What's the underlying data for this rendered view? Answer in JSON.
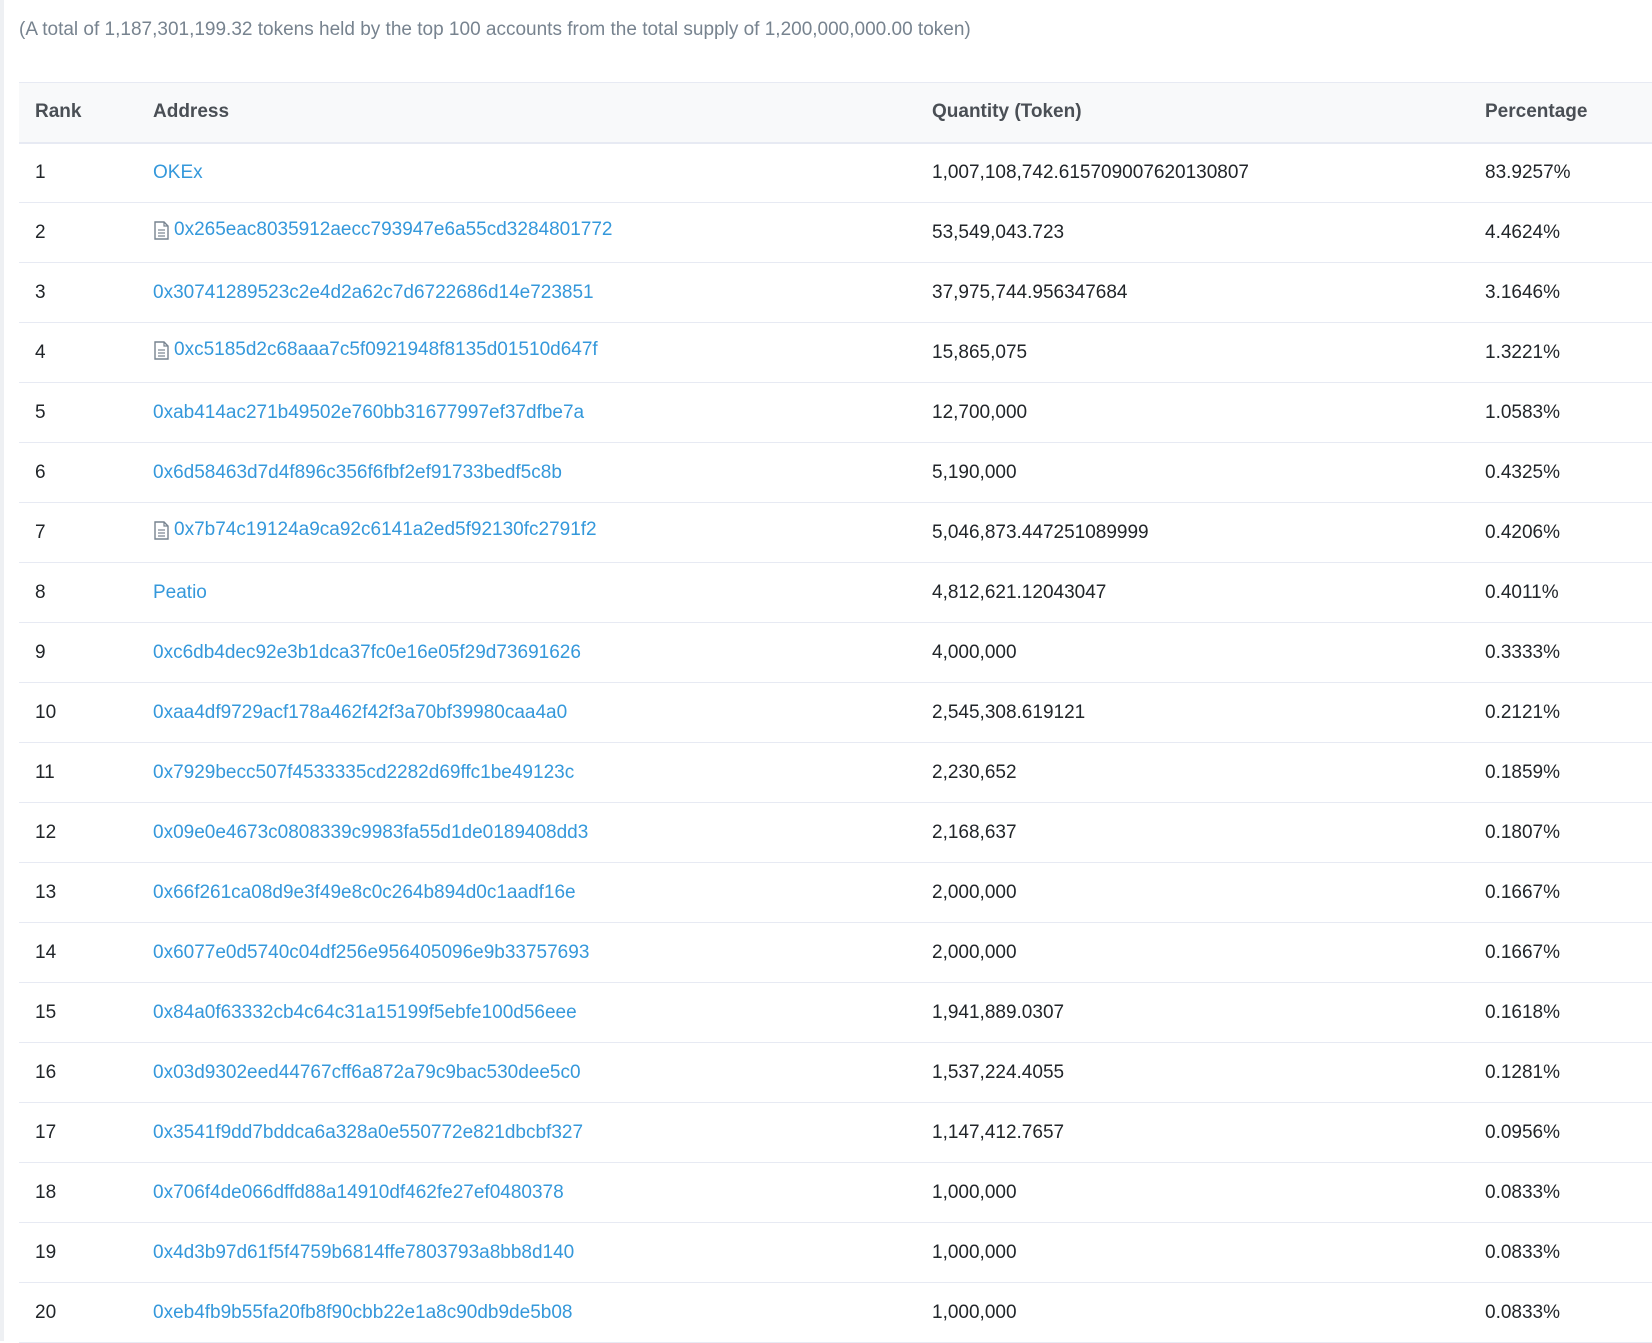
{
  "summary": "(A total of 1,187,301,199.32 tokens held by the top 100 accounts from the total supply of 1,200,000,000.00 token)",
  "table": {
    "headers": {
      "rank": "Rank",
      "address": "Address",
      "quantity": "Quantity (Token)",
      "percentage": "Percentage"
    },
    "rows": [
      {
        "rank": "1",
        "address": "OKEx",
        "contract": false,
        "quantity": "1,007,108,742.615709007620130807",
        "percentage": "83.9257%"
      },
      {
        "rank": "2",
        "address": "0x265eac8035912aecc793947e6a55cd3284801772",
        "contract": true,
        "quantity": "53,549,043.723",
        "percentage": "4.4624%"
      },
      {
        "rank": "3",
        "address": "0x30741289523c2e4d2a62c7d6722686d14e723851",
        "contract": false,
        "quantity": "37,975,744.956347684",
        "percentage": "3.1646%"
      },
      {
        "rank": "4",
        "address": "0xc5185d2c68aaa7c5f0921948f8135d01510d647f",
        "contract": true,
        "quantity": "15,865,075",
        "percentage": "1.3221%"
      },
      {
        "rank": "5",
        "address": "0xab414ac271b49502e760bb31677997ef37dfbe7a",
        "contract": false,
        "quantity": "12,700,000",
        "percentage": "1.0583%"
      },
      {
        "rank": "6",
        "address": "0x6d58463d7d4f896c356f6fbf2ef91733bedf5c8b",
        "contract": false,
        "quantity": "5,190,000",
        "percentage": "0.4325%"
      },
      {
        "rank": "7",
        "address": "0x7b74c19124a9ca92c6141a2ed5f92130fc2791f2",
        "contract": true,
        "quantity": "5,046,873.447251089999",
        "percentage": "0.4206%"
      },
      {
        "rank": "8",
        "address": "Peatio",
        "contract": false,
        "quantity": "4,812,621.12043047",
        "percentage": "0.4011%"
      },
      {
        "rank": "9",
        "address": "0xc6db4dec92e3b1dca37fc0e16e05f29d73691626",
        "contract": false,
        "quantity": "4,000,000",
        "percentage": "0.3333%"
      },
      {
        "rank": "10",
        "address": "0xaa4df9729acf178a462f42f3a70bf39980caa4a0",
        "contract": false,
        "quantity": "2,545,308.619121",
        "percentage": "0.2121%"
      },
      {
        "rank": "11",
        "address": "0x7929becc507f4533335cd2282d69ffc1be49123c",
        "contract": false,
        "quantity": "2,230,652",
        "percentage": "0.1859%"
      },
      {
        "rank": "12",
        "address": "0x09e0e4673c0808339c9983fa55d1de0189408dd3",
        "contract": false,
        "quantity": "2,168,637",
        "percentage": "0.1807%"
      },
      {
        "rank": "13",
        "address": "0x66f261ca08d9e3f49e8c0c264b894d0c1aadf16e",
        "contract": false,
        "quantity": "2,000,000",
        "percentage": "0.1667%"
      },
      {
        "rank": "14",
        "address": "0x6077e0d5740c04df256e956405096e9b33757693",
        "contract": false,
        "quantity": "2,000,000",
        "percentage": "0.1667%"
      },
      {
        "rank": "15",
        "address": "0x84a0f63332cb4c64c31a15199f5ebfe100d56eee",
        "contract": false,
        "quantity": "1,941,889.0307",
        "percentage": "0.1618%"
      },
      {
        "rank": "16",
        "address": "0x03d9302eed44767cff6a872a79c9bac530dee5c0",
        "contract": false,
        "quantity": "1,537,224.4055",
        "percentage": "0.1281%"
      },
      {
        "rank": "17",
        "address": "0x3541f9dd7bddca6a328a0e550772e821dbcbf327",
        "contract": false,
        "quantity": "1,147,412.7657",
        "percentage": "0.0956%"
      },
      {
        "rank": "18",
        "address": "0x706f4de066dffd88a14910df462fe27ef0480378",
        "contract": false,
        "quantity": "1,000,000",
        "percentage": "0.0833%"
      },
      {
        "rank": "19",
        "address": "0x4d3b97d61f5f4759b6814ffe7803793a8bb8d140",
        "contract": false,
        "quantity": "1,000,000",
        "percentage": "0.0833%"
      },
      {
        "rank": "20",
        "address": "0xeb4fb9b55fa20fb8f90cbb22e1a8c90db9de5b08",
        "contract": false,
        "quantity": "1,000,000",
        "percentage": "0.0833%"
      }
    ]
  },
  "icons": {
    "contract": "contract-file-icon"
  },
  "colors": {
    "link": "#3498db",
    "muted": "#77838f",
    "header_bg": "#f8f9fa",
    "border": "#e7eaf3"
  }
}
